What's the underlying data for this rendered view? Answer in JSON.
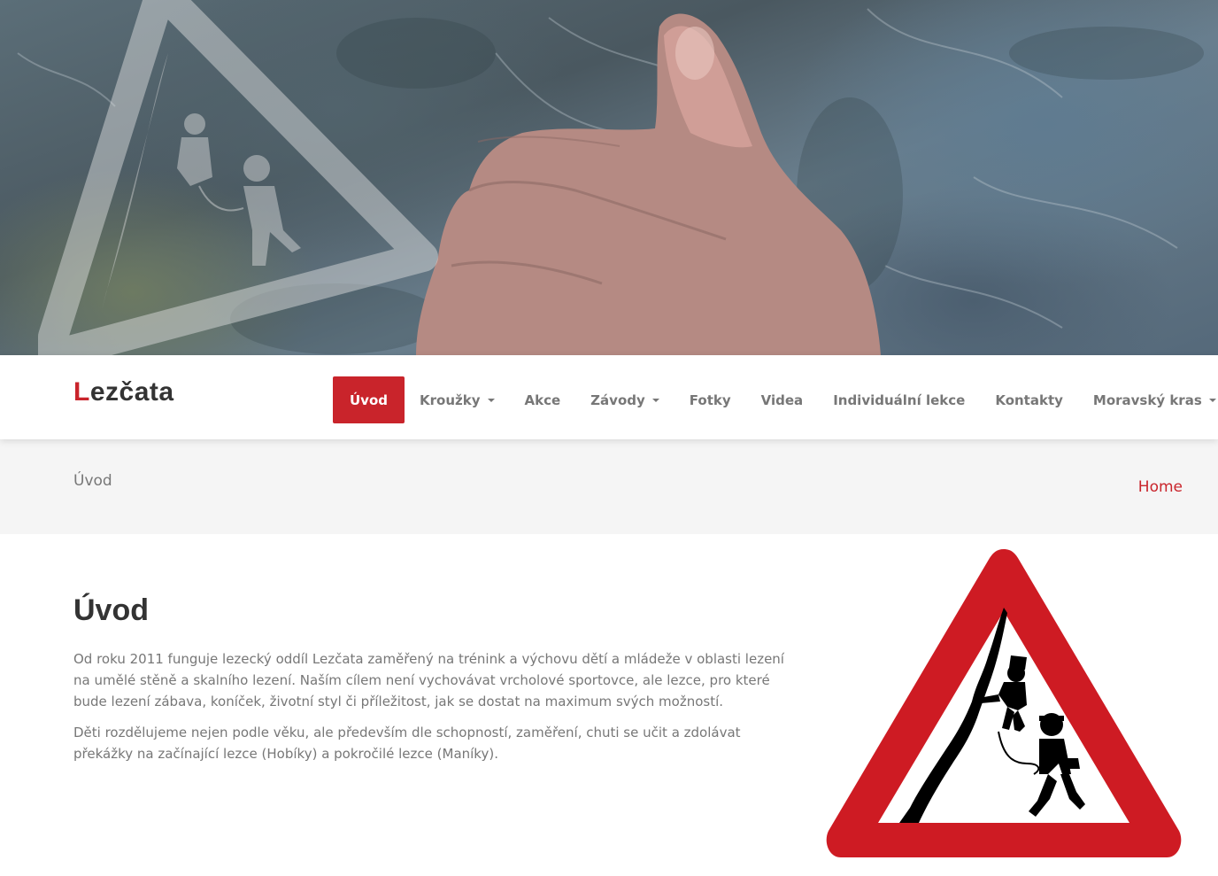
{
  "brand": {
    "first_letter": "L",
    "rest": "ezčata"
  },
  "nav": {
    "items": [
      {
        "label": "Úvod",
        "active": true,
        "dropdown": false
      },
      {
        "label": "Kroužky",
        "active": false,
        "dropdown": true
      },
      {
        "label": "Akce",
        "active": false,
        "dropdown": false
      },
      {
        "label": "Závody",
        "active": false,
        "dropdown": true
      },
      {
        "label": "Fotky",
        "active": false,
        "dropdown": false
      },
      {
        "label": "Videa",
        "active": false,
        "dropdown": false
      },
      {
        "label": "Individuální lekce",
        "active": false,
        "dropdown": false
      },
      {
        "label": "Kontakty",
        "active": false,
        "dropdown": false
      },
      {
        "label": "Moravský kras",
        "active": false,
        "dropdown": true
      }
    ]
  },
  "breadcrumb": {
    "title": "Úvod",
    "home": "Home"
  },
  "main": {
    "title": "Úvod",
    "paragraphs": [
      "Od roku 2011 funguje lezecký oddíl Lezčata zaměřený na trénink a výchovu dětí a mládeže v oblasti lezení na umělé stěně a skalního lezení. Naším cílem není vychovávat vrcholové sportovce, ale lezce, pro které bude lezení zábava, koníček, životní styl či příležitost, jak se dostat na maximum svých možností.",
      "Děti rozdělujeme nejen podle věku, ale především dle schopností, zaměření, chuti se učit a zdolávat překážky na začínající lezce (Hobíky) a pokročilé lezce (Maníky)."
    ]
  },
  "colors": {
    "accent": "#c9242b",
    "text": "#777777",
    "heading": "#333333",
    "crumb_bg": "#f5f5f5"
  },
  "icons": {
    "hero_watermark": "climbing-kids-warning-sign-icon",
    "content_sign": "climbing-kids-warning-sign-icon",
    "dropdown": "caret-down-icon"
  }
}
